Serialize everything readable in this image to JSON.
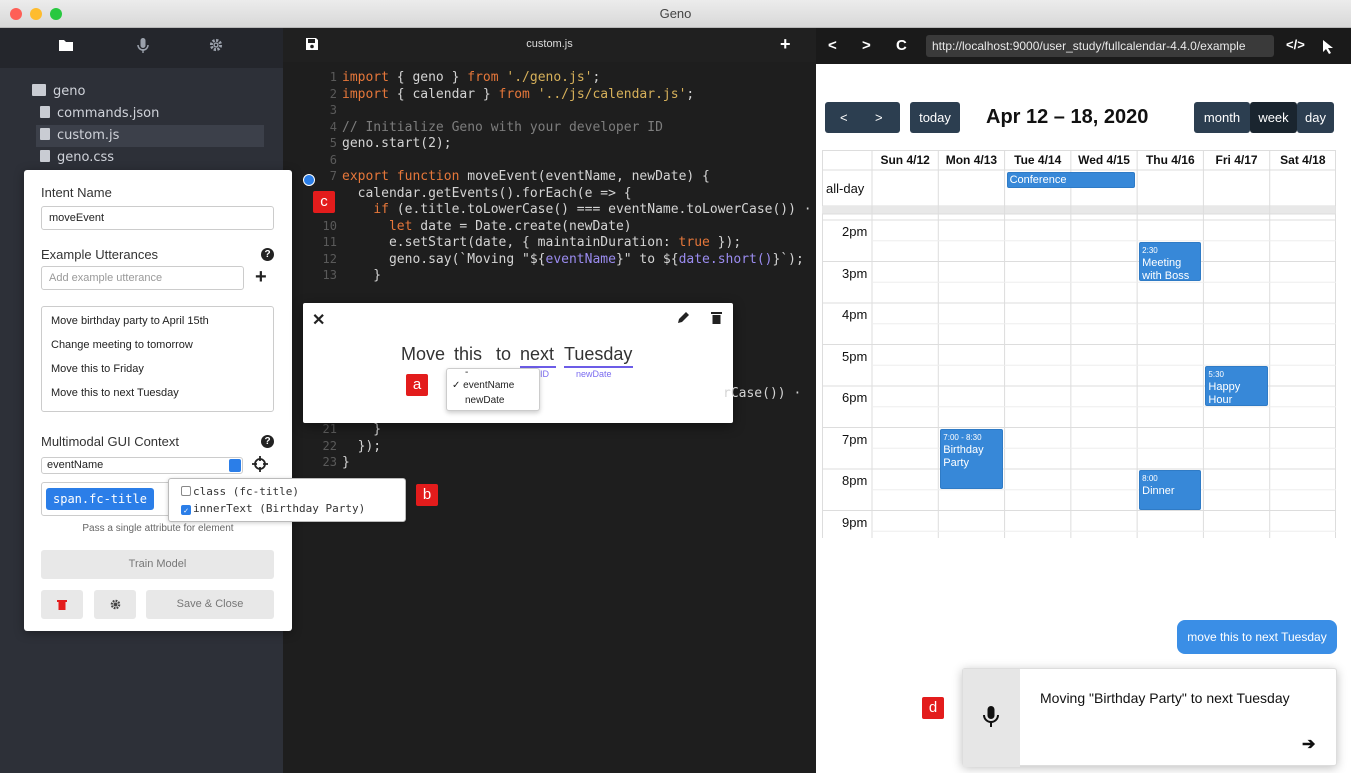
{
  "window": {
    "title": "Geno"
  },
  "sidebar": {
    "tree": {
      "folder": "geno",
      "files": [
        "commands.json",
        "custom.js",
        "geno.css"
      ]
    }
  },
  "intent_panel": {
    "intent_name_label": "Intent Name",
    "intent_name_value": "moveEvent",
    "utterances_label": "Example Utterances",
    "utterance_placeholder": "Add example utterance",
    "utterances": [
      "Move birthday party to April 15th",
      "Change meeting to tomorrow",
      "Move this to Friday",
      "Move this to next Tuesday"
    ],
    "context_label": "Multimodal GUI Context",
    "context_select": "eventName",
    "selector_chip": "span.fc-title",
    "attr_hint": "Pass a single attribute for element",
    "attr_options": [
      {
        "label": "class (fc-title)",
        "checked": false
      },
      {
        "label": "innerText (Birthday Party)",
        "checked": true
      }
    ],
    "train_button": "Train Model",
    "save_button": "Save & Close"
  },
  "editor": {
    "filename": "custom.js",
    "lines": [
      {
        "n": "1",
        "code": "import { geno } from './geno.js';"
      },
      {
        "n": "2",
        "code": "import { calendar } from '../js/calendar.js';"
      },
      {
        "n": "3",
        "code": ""
      },
      {
        "n": "4",
        "code": "// Initialize Geno with your developer ID"
      },
      {
        "n": "5",
        "code": "geno.start(2);"
      },
      {
        "n": "6",
        "code": ""
      },
      {
        "n": "7",
        "code": "export function moveEvent(eventName, newDate) {"
      },
      {
        "n": "",
        "code": "  calendar.getEvents().forEach(e => {"
      },
      {
        "n": "",
        "code": "    if (e.title.toLowerCase() === eventName.toLowerCase()) ·"
      },
      {
        "n": "10",
        "code": "      let date = Date.create(newDate)"
      },
      {
        "n": "11",
        "code": "      e.setStart(date, { maintainDuration: true });"
      },
      {
        "n": "12",
        "code": "      geno.say(`Moving \"${eventName}\" to ${date.short()}`);"
      },
      {
        "n": "13",
        "code": "    }"
      }
    ],
    "tail_lines": [
      {
        "n": "21",
        "code": "    }"
      },
      {
        "n": "22",
        "code": "  });"
      },
      {
        "n": "23",
        "code": "}"
      }
    ],
    "hidden_fragment": "rCase()) ·"
  },
  "utterance_popup": {
    "words": [
      "Move",
      "this",
      "to",
      "next",
      "Tuesday"
    ],
    "tags": [
      "ID",
      "newDate"
    ],
    "dropdown": [
      "-",
      "eventName",
      "newDate"
    ],
    "dropdown_checked": "eventName"
  },
  "badges": {
    "a": "a",
    "b": "b",
    "c": "c",
    "d": "d"
  },
  "browser": {
    "url": "http://localhost:9000/user_study/fullcalendar-4.4.0/example",
    "calendar": {
      "title": "Apr 12 – 18, 2020",
      "today": "today",
      "views": [
        "month",
        "week",
        "day"
      ],
      "active_view": "week",
      "days": [
        "Sun 4/12",
        "Mon 4/13",
        "Tue 4/14",
        "Wed 4/15",
        "Thu 4/16",
        "Fri 4/17",
        "Sat 4/18"
      ],
      "allday_label": "all-day",
      "hours": [
        "2pm",
        "3pm",
        "4pm",
        "5pm",
        "6pm",
        "7pm",
        "8pm",
        "9pm"
      ],
      "events": [
        {
          "title": "Conference",
          "time": ""
        },
        {
          "title": "Meeting with Boss",
          "time": "2:30"
        },
        {
          "title": "Happy Hour",
          "time": "5:30"
        },
        {
          "title": "Birthday Party",
          "time": "7:00 - 8:30"
        },
        {
          "title": "Dinner",
          "time": "8:00"
        }
      ]
    }
  },
  "assistant": {
    "user_bubble": "move this to next Tuesday",
    "response": "Moving \"Birthday Party\" to next Tuesday"
  }
}
